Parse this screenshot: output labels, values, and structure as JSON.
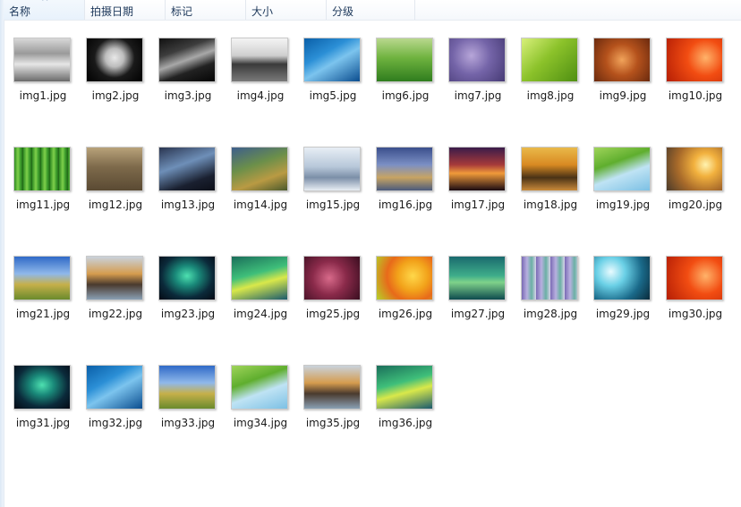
{
  "columns": [
    {
      "label": "名称",
      "sorted": true
    },
    {
      "label": "拍摄日期",
      "sorted": false
    },
    {
      "label": "标记",
      "sorted": false
    },
    {
      "label": "大小",
      "sorted": false
    },
    {
      "label": "分级",
      "sorted": false
    }
  ],
  "sort_indicator": "^",
  "files": [
    {
      "name": "img1.jpg",
      "thumb": "linear-gradient(180deg,#d8d8d8 0%,#9a9a9a 35%,#e6e6e6 60%,#6a6a6a 100%)"
    },
    {
      "name": "img2.jpg",
      "thumb": "radial-gradient(circle at 50% 45%,#e8e8e8 0%,#bdbdbd 25%,#1a1a1a 55%,#000 100%)"
    },
    {
      "name": "img3.jpg",
      "thumb": "linear-gradient(160deg,#111 0%,#3d3d3d 30%,#a8a8a8 50%,#222 70%,#050505 100%)"
    },
    {
      "name": "img4.jpg",
      "thumb": "linear-gradient(180deg,#f4f4f4 0%,#cfcfcf 40%,#3a3a3a 60%,#7a7a7a 100%)"
    },
    {
      "name": "img5.jpg",
      "thumb": "linear-gradient(150deg,#0a5fa8 0%,#2b8fd6 35%,#7cc4ee 55%,#0b4d8f 100%)"
    },
    {
      "name": "img6.jpg",
      "thumb": "linear-gradient(180deg,#b9d88e 0%,#6fb33f 45%,#2f7d1e 100%)"
    },
    {
      "name": "img7.jpg",
      "thumb": "radial-gradient(circle at 40% 40%,#b7a6d9 0%,#7464a8 45%,#463a74 100%)"
    },
    {
      "name": "img8.jpg",
      "thumb": "linear-gradient(135deg,#d8f07a 0%,#8bc22a 45%,#4f8f12 100%)"
    },
    {
      "name": "img9.jpg",
      "thumb": "radial-gradient(circle at 50% 50%,#f1a35a 0%,#b5521c 45%,#6b2a0e 100%)"
    },
    {
      "name": "img10.jpg",
      "thumb": "radial-gradient(circle at 70% 45%,#ffb36a 0%,#f24d12 40%,#b51e05 100%)"
    },
    {
      "name": "img11.jpg",
      "thumb": "repeating-linear-gradient(90deg,#2f8a23 0px,#7fd14b 4px,#3c9c2c 7px,#1f6515 10px)"
    },
    {
      "name": "img12.jpg",
      "thumb": "linear-gradient(180deg,#b8a27a 0%,#7e6a4b 45%,#5a4a33 100%)"
    },
    {
      "name": "img13.jpg",
      "thumb": "linear-gradient(160deg,#2a3550 0%,#6e8fb8 40%,#1a2030 75%,#0c0f18 100%)"
    },
    {
      "name": "img14.jpg",
      "thumb": "linear-gradient(160deg,#3d5e8c 0%,#6b8f4a 40%,#b99a43 70%,#4a5a2c 100%)"
    },
    {
      "name": "img15.jpg",
      "thumb": "linear-gradient(180deg,#e7eef5 0%,#b7c7d9 45%,#7c8fa8 70%,#e9eef4 100%)"
    },
    {
      "name": "img16.jpg",
      "thumb": "linear-gradient(180deg,#3b4f8c 0%,#7b8fc4 40%,#c7a463 70%,#4b5a7c 100%)"
    },
    {
      "name": "img17.jpg",
      "thumb": "linear-gradient(180deg,#3a1b4a 0%,#a63a3a 40%,#f09a3a 60%,#1a0a12 100%)"
    },
    {
      "name": "img18.jpg",
      "thumb": "linear-gradient(180deg,#e9b94a 0%,#d98a22 40%,#4a3216 70%,#c98a3a 100%)"
    },
    {
      "name": "img19.jpg",
      "thumb": "linear-gradient(160deg,#9fd45a 0%,#5fae2e 35%,#bfe3f4 60%,#7cc0e4 100%)"
    },
    {
      "name": "img20.jpg",
      "thumb": "radial-gradient(circle at 70% 40%,#fff3b0 0%,#f2b13e 25%,#a86a2a 60%,#4a3a2a 100%)"
    },
    {
      "name": "img21.jpg",
      "thumb": "linear-gradient(180deg,#2f6ac7 0%,#8fb8ea 40%,#c6b04a 65%,#6a8a2c 100%)"
    },
    {
      "name": "img22.jpg",
      "thumb": "linear-gradient(180deg,#c9d2dc 0%,#d59c4e 40%,#4a3a2e 65%,#8aa0b4 100%)"
    },
    {
      "name": "img23.jpg",
      "thumb": "radial-gradient(ellipse at 50% 45%,#4ee0b0 0%,#1a8a7a 30%,#0b2a3a 65%,#040a14 100%)"
    },
    {
      "name": "img24.jpg",
      "thumb": "linear-gradient(165deg,#1a6e5a 0%,#3fbf7a 40%,#d9e84a 60%,#1a5a6e 100%)"
    },
    {
      "name": "img25.jpg",
      "thumb": "radial-gradient(circle at 45% 50%,#d86a8a 0%,#8a2a4a 45%,#3a0e20 100%)"
    },
    {
      "name": "img26.jpg",
      "thumb": "radial-gradient(circle at 65% 45%,#ffd84a 0%,#f2a21a 35%,#e86a1a 60%,#b4d22a 100%)"
    },
    {
      "name": "img27.jpg",
      "thumb": "linear-gradient(180deg,#1a6a6e 0%,#3fae8a 45%,#7fd28a 60%,#0e4a4e 100%)"
    },
    {
      "name": "img28.jpg",
      "thumb": "repeating-linear-gradient(90deg,#7a6ab4 0px,#b8b0e0 6px,#6ab0a4 11px,#d8d2ea 16px)"
    },
    {
      "name": "img29.jpg",
      "thumb": "radial-gradient(circle at 30% 35%,#e9fbff 0%,#6ad0e6 30%,#1a6a8a 65%,#0a2a3a 100%)"
    },
    {
      "name": "img30.jpg",
      "thumb": "radial-gradient(circle at 70% 45%,#ffb36a 0%,#f24d12 40%,#b51e05 100%)"
    },
    {
      "name": "img31.jpg",
      "thumb": "radial-gradient(ellipse at 50% 45%,#4ee0b0 0%,#1a8a7a 30%,#0b2a3a 65%,#040a14 100%)"
    },
    {
      "name": "img32.jpg",
      "thumb": "linear-gradient(150deg,#0a5fa8 0%,#2b8fd6 35%,#7cc4ee 55%,#0b4d8f 100%)"
    },
    {
      "name": "img33.jpg",
      "thumb": "linear-gradient(180deg,#2f6ac7 0%,#8fb8ea 40%,#c6b04a 65%,#6a8a2c 100%)"
    },
    {
      "name": "img34.jpg",
      "thumb": "linear-gradient(160deg,#9fd45a 0%,#5fae2e 35%,#bfe3f4 60%,#7cc0e4 100%)"
    },
    {
      "name": "img35.jpg",
      "thumb": "linear-gradient(180deg,#c9d2dc 0%,#d59c4e 40%,#4a3a2e 65%,#8aa0b4 100%)"
    },
    {
      "name": "img36.jpg",
      "thumb": "linear-gradient(165deg,#1a6e5a 0%,#3fbf7a 40%,#d9e84a 60%,#1a5a6e 100%)"
    }
  ]
}
